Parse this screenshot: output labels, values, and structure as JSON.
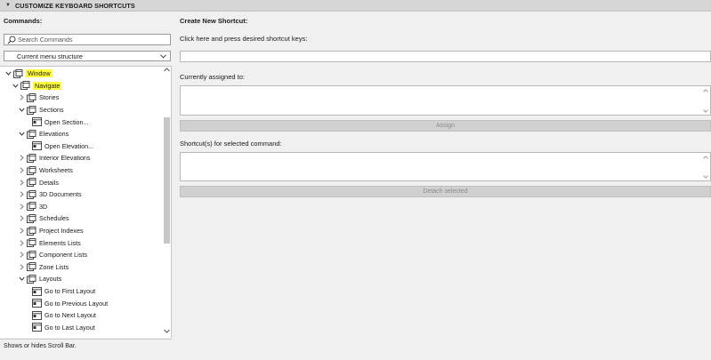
{
  "panel": {
    "title": "CUSTOMIZE KEYBOARD SHORTCUTS"
  },
  "left": {
    "commands_label": "Commands:",
    "search_placeholder": "Search Commands",
    "menu_select_value": "Current menu structure",
    "status_text": "Shows or hides Scroll Bar."
  },
  "tree": [
    {
      "label": "Window",
      "level": 0,
      "expander": "open",
      "icon": "window-icon",
      "highlight": true
    },
    {
      "label": "Navigate",
      "level": 1,
      "expander": "open",
      "icon": "folder-icon",
      "highlight": true
    },
    {
      "label": "Stories",
      "level": 2,
      "expander": "closed",
      "icon": "folder-icon",
      "highlight": false
    },
    {
      "label": "Sections",
      "level": 2,
      "expander": "open",
      "icon": "folder-icon",
      "highlight": false
    },
    {
      "label": "Open Section...",
      "level": 3,
      "expander": "none",
      "icon": "command-icon",
      "highlight": false
    },
    {
      "label": "Elevations",
      "level": 2,
      "expander": "open",
      "icon": "folder-icon",
      "highlight": false
    },
    {
      "label": "Open Elevation...",
      "level": 3,
      "expander": "none",
      "icon": "command-icon",
      "highlight": false
    },
    {
      "label": "Interior Elevations",
      "level": 2,
      "expander": "closed",
      "icon": "folder-icon",
      "highlight": false
    },
    {
      "label": "Worksheets",
      "level": 2,
      "expander": "closed",
      "icon": "folder-icon",
      "highlight": false
    },
    {
      "label": "Details",
      "level": 2,
      "expander": "closed",
      "icon": "folder-icon",
      "highlight": false
    },
    {
      "label": "3D Documents",
      "level": 2,
      "expander": "closed",
      "icon": "folder-icon",
      "highlight": false
    },
    {
      "label": "3D",
      "level": 2,
      "expander": "closed",
      "icon": "folder-icon",
      "highlight": false
    },
    {
      "label": "Schedules",
      "level": 2,
      "expander": "closed",
      "icon": "folder-icon",
      "highlight": false
    },
    {
      "label": "Project Indexes",
      "level": 2,
      "expander": "closed",
      "icon": "folder-icon",
      "highlight": false
    },
    {
      "label": "Elements Lists",
      "level": 2,
      "expander": "closed",
      "icon": "folder-icon",
      "highlight": false
    },
    {
      "label": "Component Lists",
      "level": 2,
      "expander": "closed",
      "icon": "folder-icon",
      "highlight": false
    },
    {
      "label": "Zone Lists",
      "level": 2,
      "expander": "closed",
      "icon": "folder-icon",
      "highlight": false
    },
    {
      "label": "Layouts",
      "level": 2,
      "expander": "open",
      "icon": "folder-icon",
      "highlight": false
    },
    {
      "label": "Go to First Layout",
      "level": 3,
      "expander": "none",
      "icon": "command-icon",
      "highlight": false
    },
    {
      "label": "Go to Previous Layout",
      "level": 3,
      "expander": "none",
      "icon": "command-icon",
      "highlight": false
    },
    {
      "label": "Go to Next Layout",
      "level": 3,
      "expander": "none",
      "icon": "command-icon",
      "highlight": false
    },
    {
      "label": "Go to Last Layout",
      "level": 3,
      "expander": "none",
      "icon": "command-icon",
      "highlight": false
    }
  ],
  "right": {
    "create_label": "Create New Shortcut:",
    "press_label": "Click here and press desired shortcut keys:",
    "assigned_label": "Currently assigned to:",
    "assign_button": "Assign",
    "shortcuts_label": "Shortcut(s) for selected command:",
    "detach_button": "Detach selected"
  },
  "colors": {
    "highlight": "#ffff3a",
    "panel_bg": "#f0f0f0",
    "header_bg": "#d6d6d6",
    "button_disabled": "#d0d0d0"
  }
}
